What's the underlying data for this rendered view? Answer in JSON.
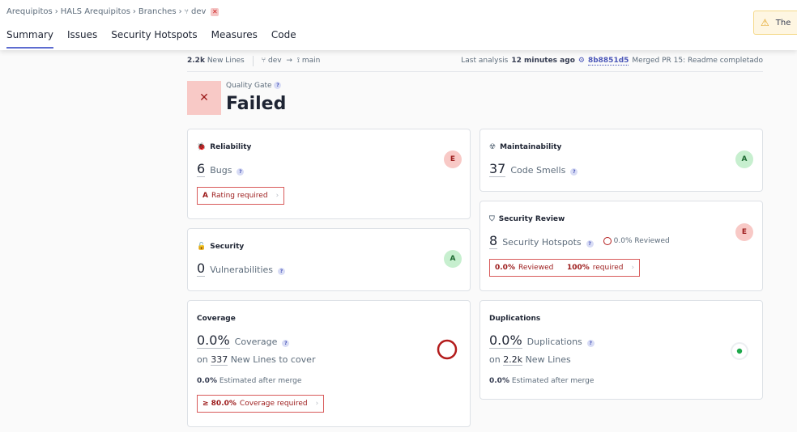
{
  "breadcrumb": {
    "org": "Arequipitos",
    "project": "HALS Arequipitos",
    "branches": "Branches",
    "branch": "dev",
    "branch_icon": "branch-icon",
    "close_icon": "close-icon"
  },
  "tabs": [
    "Summary",
    "Issues",
    "Security Hotspots",
    "Measures",
    "Code"
  ],
  "warning": {
    "text": "The",
    "icon": "warning-icon"
  },
  "infobar": {
    "new_lines": "2.2k",
    "new_lines_label": "New Lines",
    "branch_from": "dev",
    "arrow": "→",
    "branch_to": "main",
    "analysis_prefix": "Last analysis",
    "analysis_time": "12 minutes ago",
    "commit": "8b8851d5",
    "merged_text": "Merged PR 15: Readme completado"
  },
  "quality_gate": {
    "label": "Quality Gate",
    "status": "Failed",
    "icon": "close-icon"
  },
  "reliability": {
    "title": "Reliability",
    "value": "6",
    "label": "Bugs",
    "rating": "E",
    "condition_rating": "A",
    "condition_text": "Rating required",
    "icon": "bug-icon"
  },
  "maintainability": {
    "title": "Maintainability",
    "value": "37",
    "label": "Code Smells",
    "rating": "A",
    "icon": "gauge-icon"
  },
  "security": {
    "title": "Security",
    "value": "0",
    "label": "Vulnerabilities",
    "rating": "A",
    "icon": "lock-icon"
  },
  "security_review": {
    "title": "Security Review",
    "value": "8",
    "label": "Security Hotspots",
    "reviewed": "0.0% Reviewed",
    "rating": "E",
    "cond_reviewed": "0.0%",
    "cond_reviewed_label": "Reviewed",
    "cond_required": "100%",
    "cond_required_label": "required",
    "icon": "shield-icon"
  },
  "coverage": {
    "title": "Coverage",
    "value": "0.0%",
    "label": "Coverage",
    "sub_prefix": "on",
    "sub_value": "337",
    "sub_label": "New Lines to cover",
    "est_value": "0.0%",
    "est_label": "Estimated after merge",
    "cond_value": "≥ 80.0%",
    "cond_text": "Coverage required",
    "coverage_fraction": 0.0
  },
  "duplications": {
    "title": "Duplications",
    "value": "0.0%",
    "label": "Duplications",
    "sub_prefix": "on",
    "sub_value": "2.2k",
    "sub_label": "New Lines",
    "est_value": "0.0%",
    "est_label": "Estimated after merge"
  },
  "colors": {
    "accent": "#5d6cd0",
    "failed": "#9c1b1b",
    "failed_bg": "#f8c9c6",
    "good_bg": "#c7efcf",
    "dup_dot": "#1ea84b"
  }
}
